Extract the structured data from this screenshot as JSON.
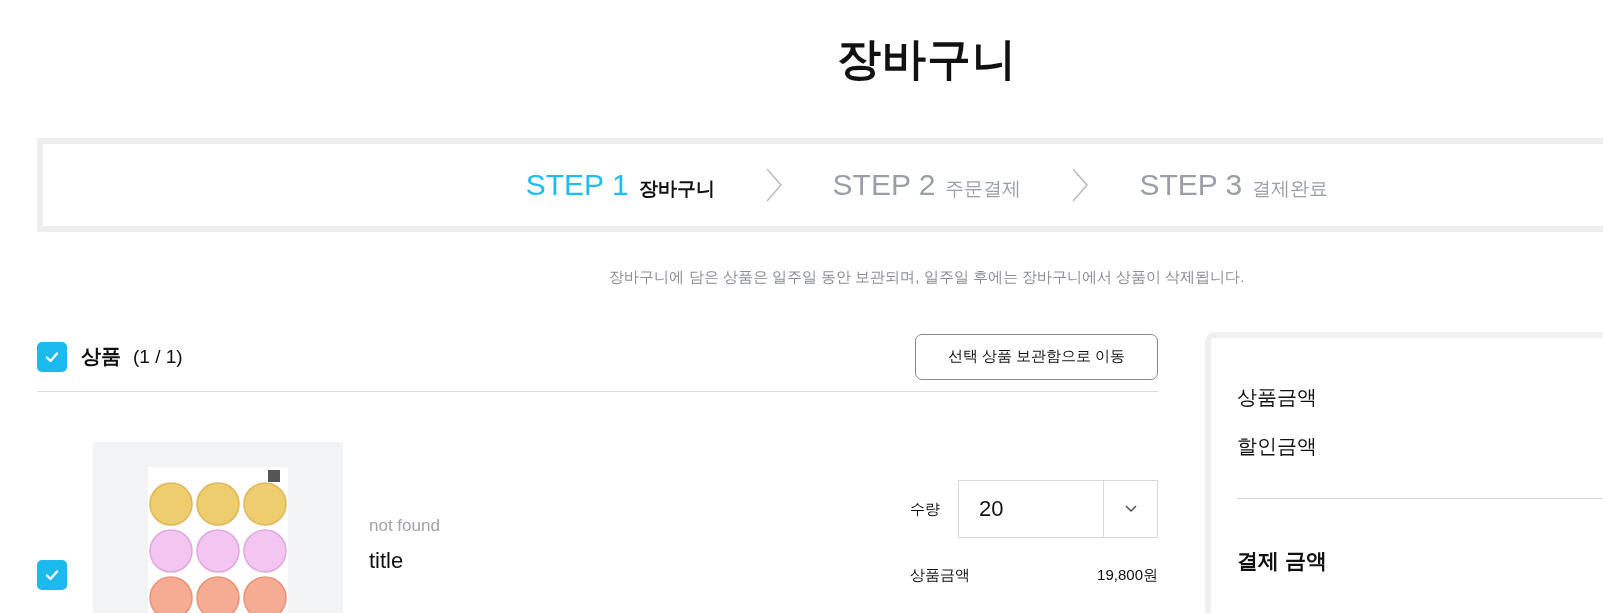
{
  "page_title": "장바구니",
  "steps": [
    {
      "label": "STEP 1",
      "name": "장바구니",
      "selected": true
    },
    {
      "label": "STEP 2",
      "name": "주문결제",
      "selected": false
    },
    {
      "label": "STEP 3",
      "name": "결제완료",
      "selected": false
    }
  ],
  "notice": "장바구니에 담은 상품은 일주일 동안 보관되며, 일주일 후에는 장바구니에서 상품이 삭제됩니다.",
  "cart": {
    "select_all": {
      "checked": true
    },
    "heading": "상품",
    "count": "(1 / 1)",
    "move_button": "선택 상품 보관함으로 이동",
    "items": [
      {
        "checked": true,
        "subtitle": "not found",
        "title": "title",
        "quantity_label": "수량",
        "quantity": "20",
        "price_label": "상품금액",
        "price": "19,800원"
      }
    ]
  },
  "summary": {
    "rows": [
      {
        "label": "상품금액"
      },
      {
        "label": "할인금액"
      }
    ],
    "total_label": "결제 금액"
  }
}
